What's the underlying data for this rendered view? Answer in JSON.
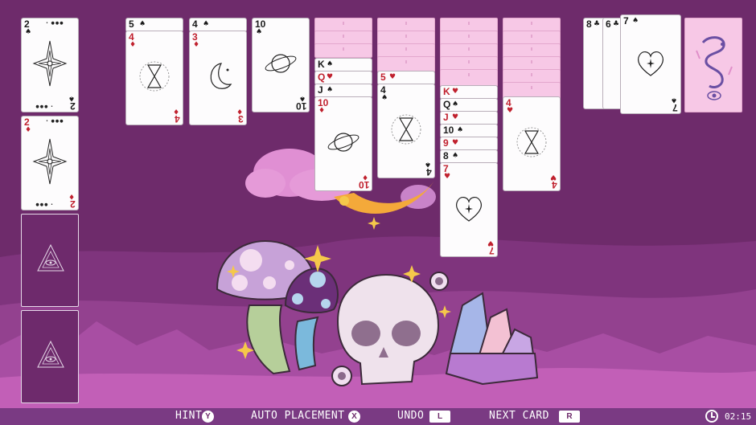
{
  "foundations": [
    {
      "rank": "2",
      "suit": "♠",
      "color": "black",
      "art": "star-icon"
    },
    {
      "rank": "2",
      "suit": "♦",
      "color": "red",
      "art": "star-icon"
    }
  ],
  "tableau": {
    "col1": [
      {
        "rank": "5",
        "suit": "♠",
        "color": "black"
      },
      {
        "rank": "4",
        "suit": "♦",
        "color": "red",
        "art": "hourglass-icon"
      }
    ],
    "col2": [
      {
        "rank": "4",
        "suit": "♠",
        "color": "black"
      },
      {
        "rank": "3",
        "suit": "♦",
        "color": "red",
        "art": "moon-icon"
      }
    ],
    "col3": [
      {
        "rank": "10",
        "suit": "♠",
        "color": "black",
        "art": "planet-icon"
      }
    ],
    "col4": [
      {
        "rank": "K",
        "suit": "♠",
        "color": "black"
      },
      {
        "rank": "Q",
        "suit": "♥",
        "color": "red"
      },
      {
        "rank": "J",
        "suit": "♠",
        "color": "black"
      },
      {
        "rank": "10",
        "suit": "♦",
        "color": "red",
        "art": "planet-icon"
      }
    ],
    "col5": [
      {
        "rank": "5",
        "suit": "♥",
        "color": "red"
      },
      {
        "rank": "4",
        "suit": "♠",
        "color": "black",
        "art": "hourglass-icon"
      }
    ],
    "col6": [
      {
        "rank": "K",
        "suit": "♥",
        "color": "red"
      },
      {
        "rank": "Q",
        "suit": "♠",
        "color": "black"
      },
      {
        "rank": "J",
        "suit": "♥",
        "color": "red"
      },
      {
        "rank": "10",
        "suit": "♠",
        "color": "black"
      },
      {
        "rank": "9",
        "suit": "♥",
        "color": "red"
      },
      {
        "rank": "8",
        "suit": "♠",
        "color": "black"
      },
      {
        "rank": "7",
        "suit": "♥",
        "color": "red",
        "art": "heart-icon"
      }
    ],
    "col7": [
      {
        "rank": "4",
        "suit": "♥",
        "color": "red",
        "art": "hourglass-icon"
      }
    ]
  },
  "waste": [
    {
      "rank": "8",
      "suit": "♣",
      "color": "black"
    },
    {
      "rank": "6",
      "suit": "♣",
      "color": "black"
    },
    {
      "rank": "7",
      "suit": "♠",
      "color": "black",
      "art": "heart-icon"
    }
  ],
  "controls": {
    "hint": "HINT",
    "hint_key": "Y",
    "auto": "AUTO PLACEMENT",
    "auto_key": "X",
    "undo": "UNDO",
    "undo_key": "L",
    "next": "NEXT CARD",
    "next_key": "R",
    "timer": "02:15"
  },
  "colors": {
    "background": "#6e2b6b",
    "card_back": "#f7c8e6",
    "red_suit": "#c0212e"
  }
}
